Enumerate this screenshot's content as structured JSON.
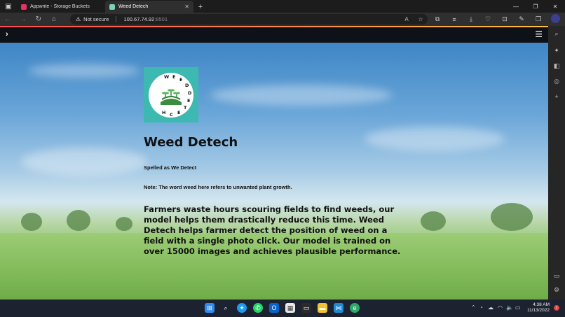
{
  "browser": {
    "tabs": [
      {
        "label": "Appwrite - Storage Buckets",
        "favicon_color": "#f02e65",
        "active": false
      },
      {
        "label": "Weed Detech",
        "favicon_color": "#7fd1b9",
        "active": true
      }
    ],
    "security_label": "Not secure",
    "url_host": "100.67.74.92",
    "url_port": ":8501"
  },
  "app": {
    "logo_letters": [
      "W",
      "E",
      "E",
      "D",
      "D",
      "E",
      "T",
      "E",
      "C",
      "H"
    ],
    "title": "Weed Detech",
    "subtitle": "Spelled as We Detect",
    "note": "Note: The word weed here refers to unwanted plant growth.",
    "description": "Farmers waste hours scouring fields to find weeds, our model helps them drastically reduce this time. Weed Detech helps farmer detect the position of weed on a field with a single photo click. Our model is trained on over 15000 images and achieves plausible performance."
  },
  "taskbar": {
    "time": "4:38 AM",
    "date": "11/13/2022",
    "notification_count": "1"
  },
  "colors": {
    "accent_start": "#ff4b4b",
    "accent_end": "#ffbd45",
    "logo_bg": "#3db9b2"
  }
}
